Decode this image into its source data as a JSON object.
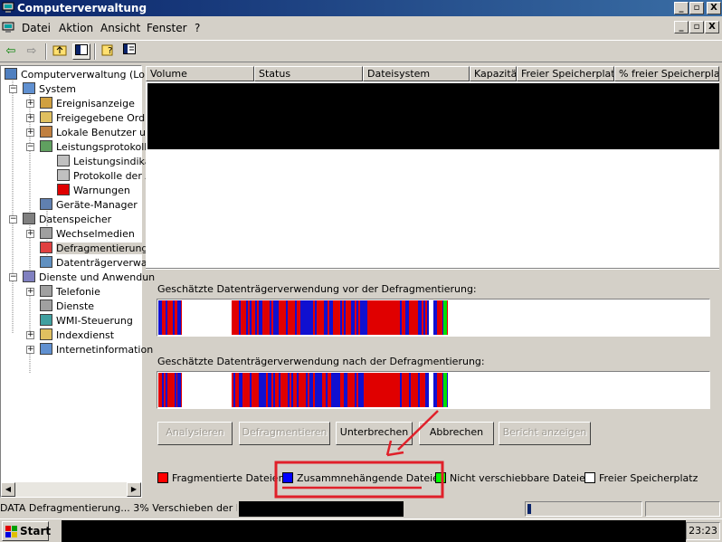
{
  "window": {
    "title": "Computerverwaltung",
    "caption_buttons": [
      "_",
      "▫",
      "X"
    ]
  },
  "menu": {
    "items": [
      "Datei",
      "Aktion",
      "Ansicht",
      "Fenster",
      "?"
    ],
    "mdi_buttons": [
      "_",
      "▫",
      "X"
    ]
  },
  "toolbar": {
    "icons": [
      "back-icon",
      "forward-icon",
      "up-folder-icon",
      "show-hide-tree-icon",
      "help-icon",
      "properties-icon"
    ]
  },
  "tree": {
    "items": [
      {
        "label": "Computerverwaltung (Loka",
        "icon": "computer-icon",
        "expander": ""
      },
      {
        "label": "System",
        "icon": "system-icon",
        "expander": "−"
      },
      {
        "label": "Ereignisanzeige",
        "icon": "event-viewer-icon",
        "expander": "+"
      },
      {
        "label": "Freigegebene Ordn",
        "icon": "shared-folders-icon",
        "expander": "+"
      },
      {
        "label": "Lokale Benutzer un",
        "icon": "users-icon",
        "expander": "+"
      },
      {
        "label": "Leistungsprotokolle",
        "icon": "performance-logs-icon",
        "expander": "−"
      },
      {
        "label": "Leistungsindika",
        "icon": "counter-log-icon",
        "expander": ""
      },
      {
        "label": "Protokolle der A",
        "icon": "trace-log-icon",
        "expander": ""
      },
      {
        "label": "Warnungen",
        "icon": "alert-icon",
        "expander": ""
      },
      {
        "label": "Geräte-Manager",
        "icon": "device-manager-icon",
        "expander": ""
      },
      {
        "label": "Datenspeicher",
        "icon": "storage-icon",
        "expander": "−"
      },
      {
        "label": "Wechselmedien",
        "icon": "removable-media-icon",
        "expander": "+"
      },
      {
        "label": "Defragmentierung",
        "icon": "defrag-icon",
        "expander": "",
        "selected": true
      },
      {
        "label": "Datenträgerverwal",
        "icon": "disk-management-icon",
        "expander": ""
      },
      {
        "label": "Dienste und Anwendun",
        "icon": "services-apps-icon",
        "expander": "−"
      },
      {
        "label": "Telefonie",
        "icon": "telephony-icon",
        "expander": "+"
      },
      {
        "label": "Dienste",
        "icon": "services-icon",
        "expander": ""
      },
      {
        "label": "WMI-Steuerung",
        "icon": "wmi-icon",
        "expander": ""
      },
      {
        "label": "Indexdienst",
        "icon": "indexing-icon",
        "expander": "+"
      },
      {
        "label": "Internetinformation",
        "icon": "iis-icon",
        "expander": "+"
      }
    ]
  },
  "list": {
    "columns": [
      "Volume",
      "Status",
      "Dateisystem",
      "Kapazität",
      "Freier Speicherplatz",
      "% freier Speicherplatz"
    ]
  },
  "analysis": {
    "before_label": "Geschätzte Datenträgerverwendung vor der Defragmentierung:",
    "after_label": "Geschätzte Datenträgerverwendung nach der Defragmentierung:"
  },
  "buttons": {
    "analyze": "Analysieren",
    "defragment": "Defragmentieren",
    "pause": "Unterbrechen",
    "stop": "Abbrechen",
    "report": "Bericht anzeigen"
  },
  "legend": [
    {
      "label": "Fragmentierte Dateien",
      "color": "#ff0000"
    },
    {
      "label": "Zusammnehängende Dateien",
      "color": "#0000ff"
    },
    {
      "label": "Nicht verschiebbare Dateien",
      "color": "#00ff00"
    },
    {
      "label": "Freier Speicherplatz",
      "color": "#ffffff"
    }
  ],
  "colors": {
    "fragmented": "#e00000",
    "contiguous": "#1010d0",
    "unmovable": "#00e000",
    "annotation": "#e0202a"
  },
  "statusbar": {
    "volume": "DATA",
    "activity": "Defragmentierung...",
    "percent": "3%",
    "message": "Verschieben der Datei",
    "progress_percent": 3
  },
  "taskbar": {
    "start_label": "Start",
    "clock": "23:23"
  }
}
